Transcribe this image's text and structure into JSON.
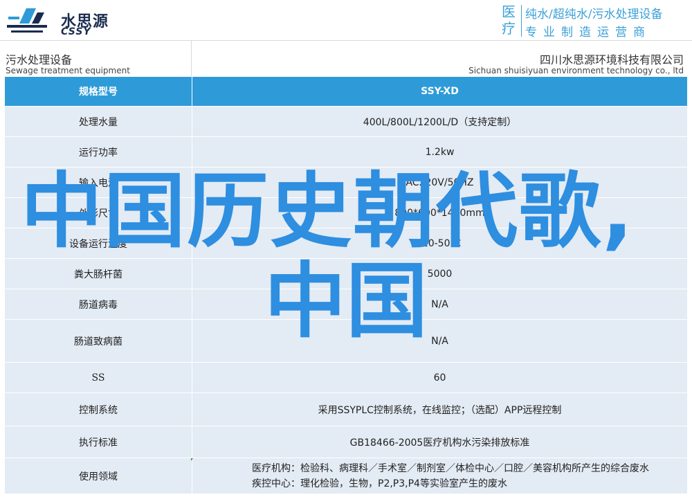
{
  "header": {
    "logo_cn": "水思源",
    "logo_en": "CSSY",
    "category_big": "医疗",
    "tagline_line1": "纯水/超纯水/污水处理设备",
    "tagline_line2": "专业制造运营商"
  },
  "subheader": {
    "product_cn": "污水处理设备",
    "product_en": "Sewage treatment equipment",
    "company_cn": "四川水思源环境科技有限公司",
    "company_en": "Sichuan shuisiyuan environment technology co., ltd"
  },
  "table": {
    "header": {
      "label": "规格型号",
      "value": "SSY-XD"
    },
    "rows": [
      {
        "label": "处理水量",
        "value": "400L/800L/1200L/D（支持定制）"
      },
      {
        "label": "运行功率",
        "value": "1.2kw"
      },
      {
        "label": "输入电源",
        "value": "AC220V/50HZ"
      },
      {
        "label": "外形尺寸",
        "value": "800*600*1400mm"
      },
      {
        "label": "设备运行温度",
        "value": "-10-50℃"
      },
      {
        "label": "粪大肠杆菌",
        "value": "5000"
      },
      {
        "label": "肠道病毒",
        "value": "N/A"
      },
      {
        "label": "肠道致病菌",
        "value": "N/A"
      },
      {
        "label": "SS",
        "value": "60"
      },
      {
        "label": "控制系统",
        "value": "采用SSYPLC控制系统，在线监控；（选配）APP远程控制"
      },
      {
        "label": "执行标准",
        "value": "GB18466-2005医疗机构水污染排放标准"
      },
      {
        "label": "使用领域",
        "value_line1": "医疗机构：检验科、病理科／手术室／制剂室／体检中心／口腔／美容机构所产生的综合废水",
        "value_line2": "疾控中心：理化检验，生物，P2,P3,P4等实验室产生的废水"
      }
    ]
  },
  "overlay": {
    "line1": "中国历史朝代歌,",
    "line2": "中国"
  },
  "colors": {
    "accent": "#2e9bd8",
    "row_bg": "#e3ebf4",
    "overlay": "#2e8ee0"
  }
}
